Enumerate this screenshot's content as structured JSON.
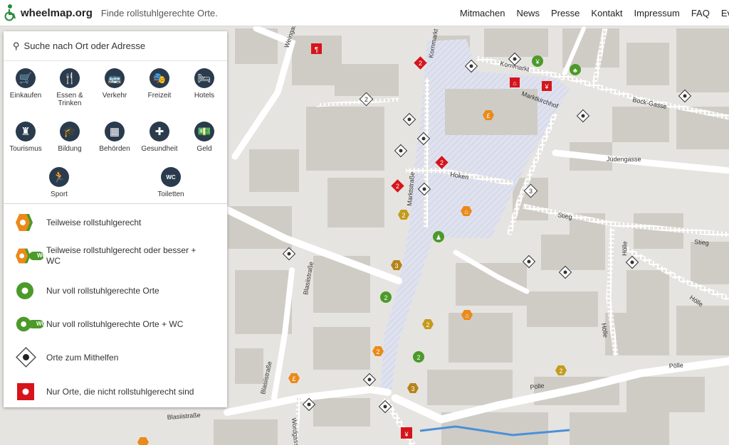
{
  "header": {
    "logo_text": "wheelmap.org",
    "tagline": "Finde rollstuhlgerechte Orte.",
    "nav": [
      "Mitmachen",
      "News",
      "Presse",
      "Kontakt",
      "Impressum",
      "FAQ",
      "Ev"
    ]
  },
  "search": {
    "placeholder": "Suche nach Ort oder Adresse"
  },
  "categories": [
    {
      "label": "Einkaufen",
      "icon": "shopping-cart-icon",
      "glyph": "🛒"
    },
    {
      "label": "Essen &\nTrinken",
      "icon": "fork-knife-icon",
      "glyph": "🍴"
    },
    {
      "label": "Verkehr",
      "icon": "bus-icon",
      "glyph": "🚌"
    },
    {
      "label": "Freizeit",
      "icon": "masks-icon",
      "glyph": "🎭"
    },
    {
      "label": "Hotels",
      "icon": "bed-icon",
      "glyph": "🛏"
    },
    {
      "label": "Tourismus",
      "icon": "castle-icon",
      "glyph": "♜"
    },
    {
      "label": "Bildung",
      "icon": "graduation-cap-icon",
      "glyph": "🎓"
    },
    {
      "label": "Behörden",
      "icon": "building-icon",
      "glyph": "▦"
    },
    {
      "label": "Gesundheit",
      "icon": "plus-icon",
      "glyph": "✚"
    },
    {
      "label": "Geld",
      "icon": "money-icon",
      "glyph": "💵"
    },
    {
      "label": "Sport",
      "icon": "runner-icon",
      "glyph": "🏃"
    },
    {
      "label": "Toiletten",
      "icon": "wc-icon",
      "glyph": "WC"
    }
  ],
  "legend": [
    {
      "text": "Teilweise rollstuhlgerecht",
      "icon": "partial-marker-icon"
    },
    {
      "text": "Teilweise rollstuhlgerecht oder besser + WC",
      "icon": "partial-wc-marker-icon"
    },
    {
      "text": "Nur voll rollstuhlgerechte Orte",
      "icon": "full-marker-icon"
    },
    {
      "text": "Nur voll rollstuhlgerechte Orte + WC",
      "icon": "full-wc-marker-icon"
    },
    {
      "text": "Orte zum Mithelfen",
      "icon": "unknown-marker-icon"
    },
    {
      "text": "Nur Orte, die nicht rollstuhlgerecht sind",
      "icon": "not-accessible-marker-icon"
    }
  ],
  "legend_wc_label": "WC",
  "map": {
    "streets": [
      "Weingasse",
      "Kornmarkt",
      "Kornmarkt",
      "Marktkirchhof",
      "Bock-Gasse",
      "Jüdengasse",
      "Hoken",
      "Marktstraße",
      "Stieg",
      "Stieg",
      "Hölle",
      "Hölle",
      "Blasiistraße",
      "Blasiistraße",
      "Blasiistraße",
      "Wordgasse",
      "Pölle",
      "Pölle",
      "Hölle"
    ],
    "marker_numbers": [
      "2",
      "2",
      "2",
      "2",
      "3",
      "3",
      "2",
      "2",
      "2",
      "2",
      "3",
      "2",
      "2"
    ]
  },
  "colors": {
    "header_bg": "#ffffff",
    "map_bg": "#e6e4e0",
    "building": "#cfccc6",
    "plaza": "#dde0ec",
    "marker_partial": "#ea8a1a",
    "marker_full": "#4c9a2a",
    "marker_not": "#d6141b",
    "marker_unknown": "#3a3a3a",
    "category_icon_bg": "#2a3b4d"
  }
}
